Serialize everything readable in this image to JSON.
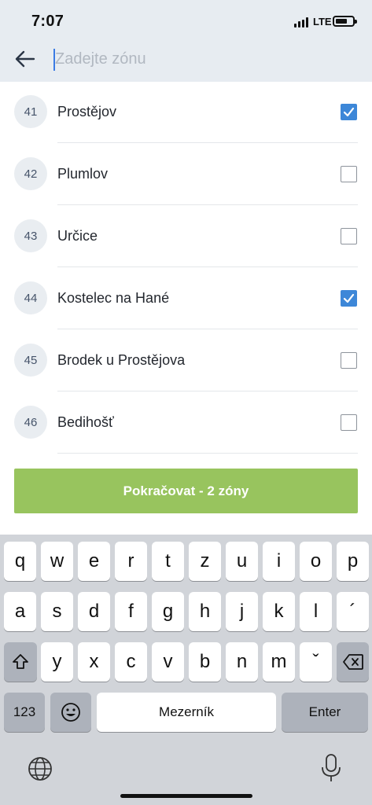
{
  "status": {
    "time": "7:07",
    "network": "LTE"
  },
  "search": {
    "placeholder": "Zadejte zónu",
    "value": ""
  },
  "zones": [
    {
      "number": "41",
      "name": "Prostějov",
      "checked": true
    },
    {
      "number": "42",
      "name": "Plumlov",
      "checked": false
    },
    {
      "number": "43",
      "name": "Určice",
      "checked": false
    },
    {
      "number": "44",
      "name": "Kostelec na Hané",
      "checked": true
    },
    {
      "number": "45",
      "name": "Brodek u Prostějova",
      "checked": false
    },
    {
      "number": "46",
      "name": "Bedihošť",
      "checked": false
    }
  ],
  "continue_label": "Pokračovat - 2 zóny",
  "keyboard": {
    "row1": [
      "q",
      "w",
      "e",
      "r",
      "t",
      "z",
      "u",
      "i",
      "o",
      "p"
    ],
    "row2": [
      "a",
      "s",
      "d",
      "f",
      "g",
      "h",
      "j",
      "k",
      "l",
      "´"
    ],
    "row3": [
      "y",
      "x",
      "c",
      "v",
      "b",
      "n",
      "m",
      "ˇ"
    ],
    "numbers_label": "123",
    "space_label": "Mezerník",
    "enter_label": "Enter"
  },
  "colors": {
    "accent": "#98c45e",
    "checkbox": "#3d87d8",
    "header_bg": "#e7ecf1"
  },
  "icons": [
    "back-arrow-icon",
    "checkmark-icon",
    "shift-icon",
    "backspace-icon",
    "emoji-icon",
    "globe-icon",
    "microphone-icon"
  ]
}
